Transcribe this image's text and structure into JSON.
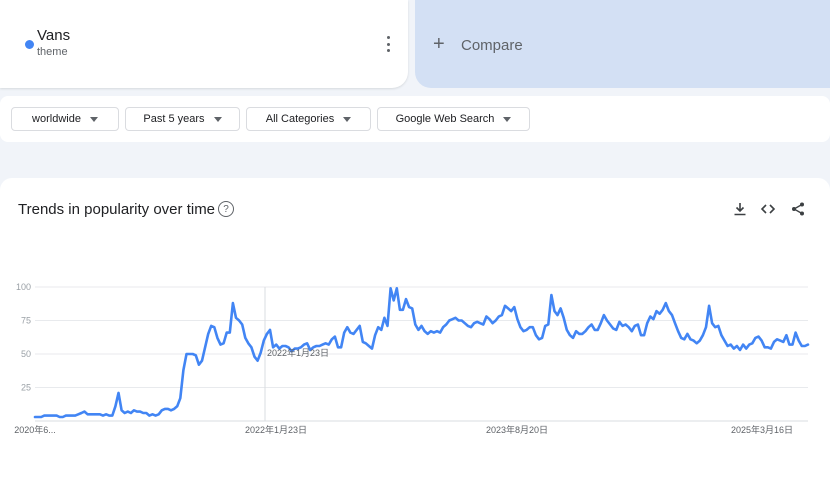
{
  "term": {
    "name": "Vans",
    "type": "theme",
    "color": "#4285f4"
  },
  "compare": {
    "icon": "plus-icon",
    "label": "Compare"
  },
  "filters": [
    "worldwide",
    "Past 5 years",
    "All Categories",
    "Google Web Search"
  ],
  "chart_header": {
    "title": "Trends in popularity over time",
    "icons": [
      "help-icon",
      "download-icon",
      "embed-icon",
      "share-icon"
    ]
  },
  "chart_data": {
    "type": "line",
    "series_color": "#4285f4",
    "ylim": [
      0,
      100
    ],
    "yticks": [
      25,
      50,
      75,
      100
    ],
    "grid": true,
    "x_tick_labels": [
      "2020年6...",
      "2022年1月23日",
      "2023年8月20日",
      "2025年3月16日"
    ],
    "hover_marker_label": "2022年1月23日",
    "values": [
      3,
      3,
      3,
      4,
      4,
      4,
      4,
      4,
      3,
      3,
      4,
      4,
      4,
      4,
      5,
      6,
      7,
      5,
      5,
      5,
      5,
      5,
      4,
      5,
      4,
      4,
      11,
      21,
      8,
      6,
      7,
      6,
      8,
      7,
      7,
      6,
      6,
      4,
      5,
      4,
      5,
      8,
      9,
      9,
      8,
      9,
      11,
      17,
      38,
      50,
      50,
      50,
      49,
      42,
      45,
      55,
      65,
      71,
      70,
      62,
      57,
      58,
      66,
      66,
      88,
      77,
      75,
      72,
      62,
      58,
      55,
      48,
      45,
      51,
      60,
      65,
      68,
      55,
      57,
      54,
      56,
      56,
      55,
      52,
      54,
      54,
      55,
      57,
      58,
      53,
      55,
      56,
      56,
      57,
      58,
      57,
      61,
      63,
      55,
      55,
      66,
      70,
      66,
      65,
      68,
      71,
      59,
      58,
      56,
      54,
      64,
      70,
      68,
      77,
      71,
      99,
      90,
      99,
      83,
      83,
      91,
      85,
      84,
      72,
      68,
      71,
      67,
      65,
      67,
      66,
      67,
      66,
      70,
      72,
      75,
      76,
      77,
      75,
      75,
      73,
      71,
      70,
      73,
      74,
      73,
      72,
      78,
      76,
      73,
      75,
      78,
      79,
      86,
      84,
      82,
      85,
      76,
      70,
      67,
      68,
      70,
      70,
      64,
      61,
      62,
      71,
      72,
      94,
      82,
      79,
      84,
      77,
      68,
      64,
      62,
      67,
      65,
      65,
      67,
      70,
      72,
      68,
      68,
      73,
      79,
      75,
      72,
      69,
      68,
      74,
      71,
      72,
      70,
      67,
      71,
      72,
      64,
      64,
      73,
      78,
      76,
      82,
      80,
      83,
      88,
      82,
      79,
      73,
      67,
      62,
      61,
      65,
      61,
      60,
      58,
      60,
      64,
      70,
      86,
      73,
      70,
      71,
      64,
      60,
      56,
      57,
      54,
      56,
      53,
      57,
      54,
      57,
      58,
      62,
      63,
      60,
      55,
      55,
      54,
      59,
      61,
      60,
      59,
      64,
      57,
      57,
      66,
      60,
      56,
      56,
      57
    ]
  }
}
